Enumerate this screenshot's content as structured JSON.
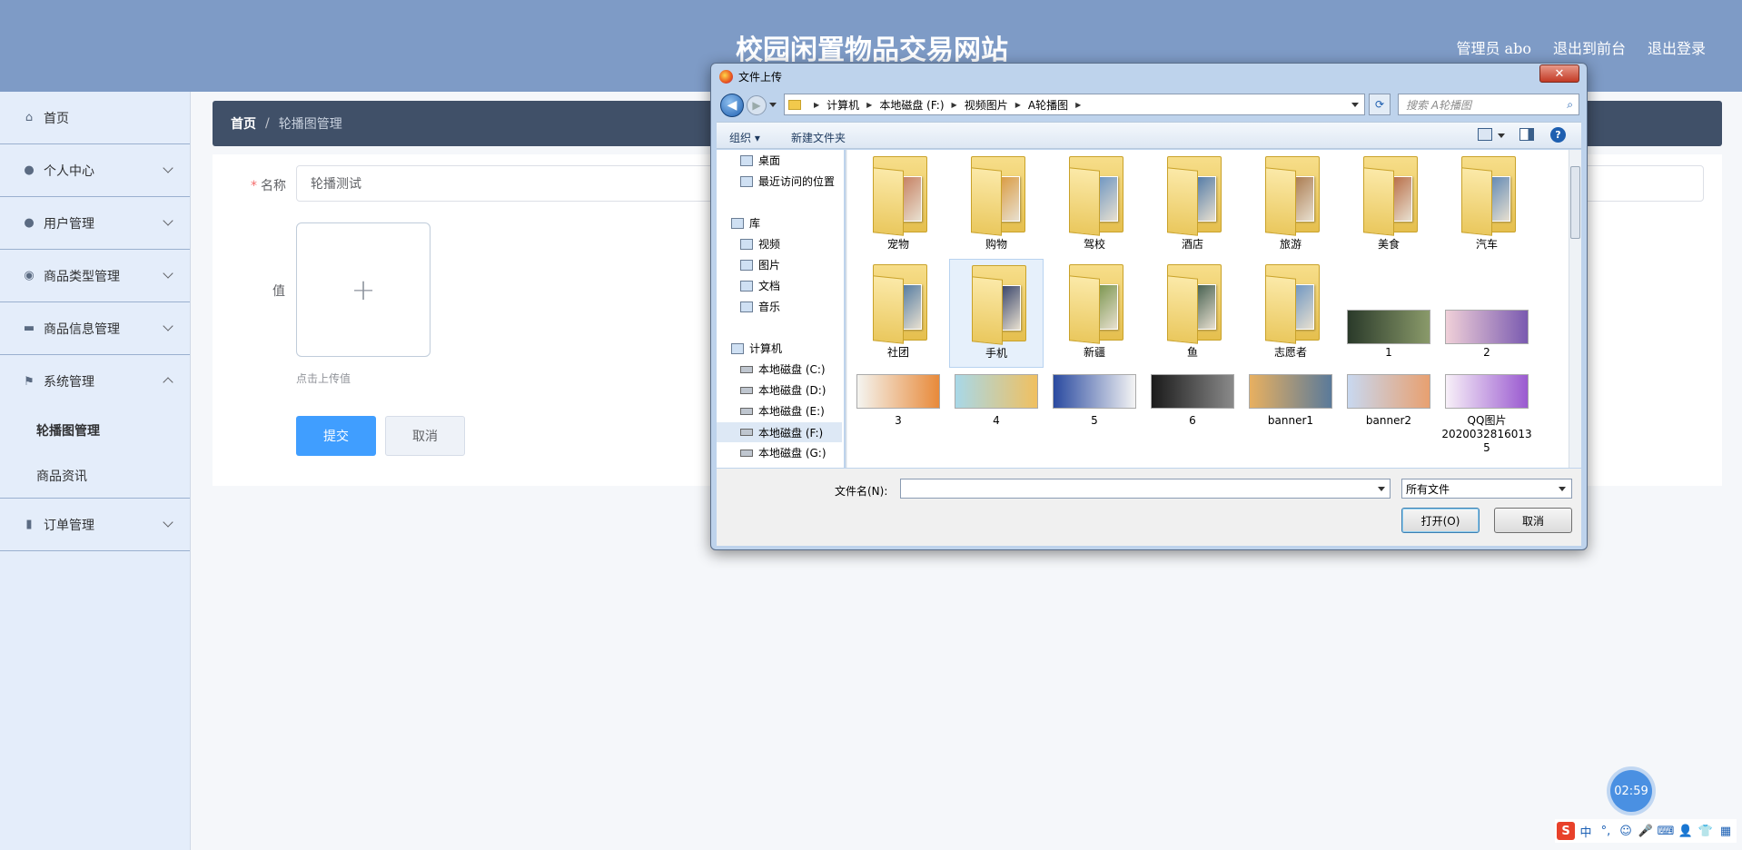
{
  "header": {
    "site_title": "校园闲置物品交易网站",
    "admin_label": "管理员 abo",
    "back_to_front": "退出到前台",
    "logout": "退出登录"
  },
  "sidebar": {
    "items": [
      {
        "label": "首页",
        "icon": "home-icon"
      },
      {
        "label": "个人中心",
        "icon": "user-icon"
      },
      {
        "label": "用户管理",
        "icon": "user-icon"
      },
      {
        "label": "商品类型管理",
        "icon": "location-icon"
      },
      {
        "label": "商品信息管理",
        "icon": "ticket-icon"
      },
      {
        "label": "系统管理",
        "icon": "flag-icon"
      },
      {
        "label": "订单管理",
        "icon": "bar-chart-icon"
      }
    ],
    "sub_items": [
      "轮播图管理",
      "商品资讯"
    ]
  },
  "breadcrumb": {
    "home": "首页",
    "separator": "/",
    "current": "轮播图管理"
  },
  "form": {
    "name_label": "名称",
    "name_value": "轮播测试",
    "value_label": "值",
    "upload_tip": "点击上传值",
    "submit": "提交",
    "cancel": "取消"
  },
  "timer": "02:59",
  "dialog": {
    "title": "文件上传",
    "close": "✕",
    "path": [
      "计算机",
      "本地磁盘 (F:)",
      "视频图片",
      "A轮播图"
    ],
    "search_placeholder": "搜索 A轮播图",
    "toolbar": {
      "organize": "组织 ▾",
      "new_folder": "新建文件夹",
      "help": "?"
    },
    "nav": {
      "desktop": "桌面",
      "recent": "最近访问的位置",
      "library": "库",
      "videos": "视频",
      "pictures": "图片",
      "documents": "文档",
      "music": "音乐",
      "computer": "计算机",
      "drives": [
        "本地磁盘 (C:)",
        "本地磁盘 (D:)",
        "本地磁盘 (E:)",
        "本地磁盘 (F:)",
        "本地磁盘 (G:)"
      ]
    },
    "folders": [
      "宠物",
      "购物",
      "驾校",
      "酒店",
      "旅游",
      "美食",
      "汽车",
      "社团",
      "手机",
      "新疆",
      "鱼",
      "志愿者"
    ],
    "images_row1": [
      "1",
      "2"
    ],
    "images_row2": [
      "3",
      "4",
      "5",
      "6",
      "banner1",
      "banner2",
      "QQ图片2020032816013 5"
    ],
    "filename_label": "文件名(N):",
    "filename_value": "",
    "filetype": "所有文件",
    "open": "打开(O)",
    "cancel": "取消"
  },
  "ime": [
    "S",
    "中",
    "°,",
    "☺",
    "🎤",
    "⌨",
    "👤",
    "👕",
    "▦"
  ]
}
